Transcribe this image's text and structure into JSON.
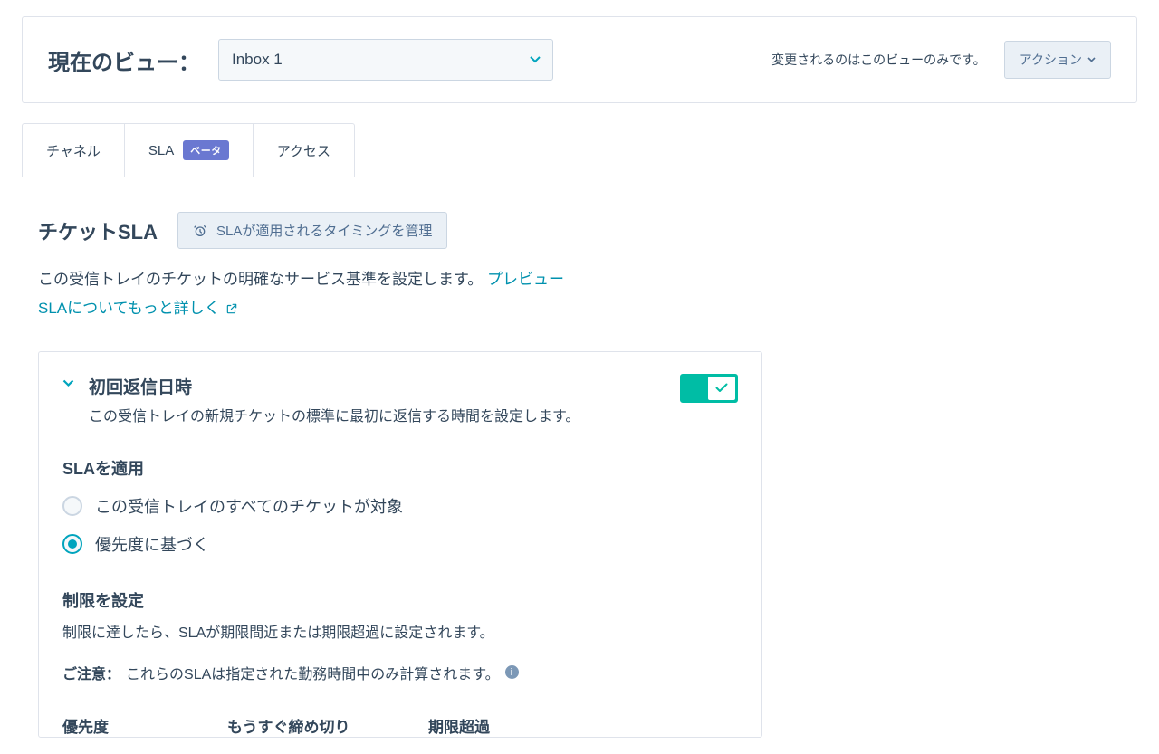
{
  "header": {
    "label": "現在のビュー：",
    "selected": "Inbox 1",
    "note": "変更されるのはこのビューのみです。",
    "actionLabel": "アクション"
  },
  "tabs": [
    {
      "label": "チャネル",
      "active": false
    },
    {
      "label": "SLA",
      "active": true,
      "badge": "ベータ"
    },
    {
      "label": "アクセス",
      "active": false
    }
  ],
  "section": {
    "title": "チケットSLA",
    "manageBtn": "SLAが適用されるタイミングを管理",
    "desc": "この受信トレイのチケットの明確なサービス基準を設定します。",
    "previewLink": "プレビュー",
    "learnMore": "SLAについてもっと詳しく"
  },
  "card": {
    "title": "初回返信日時",
    "subtitle": "この受信トレイの新規チケットの標準に最初に返信する時間を設定します。",
    "toggleOn": true,
    "applyHead": "SLAを適用",
    "radios": [
      {
        "label": "この受信トレイのすべてのチケットが対象",
        "selected": false
      },
      {
        "label": "優先度に基づく",
        "selected": true
      }
    ],
    "limitsHead": "制限を設定",
    "limitsDesc": "制限に達したら、SLAが期限間近または期限超過に設定されます。",
    "noteLabel": "ご注意：",
    "noteText": "これらのSLAは指定された勤務時間中のみ計算されます。",
    "cols": {
      "priority": "優先度",
      "dueSoon": "もうすぐ締め切り",
      "overdue": "期限超過"
    }
  }
}
